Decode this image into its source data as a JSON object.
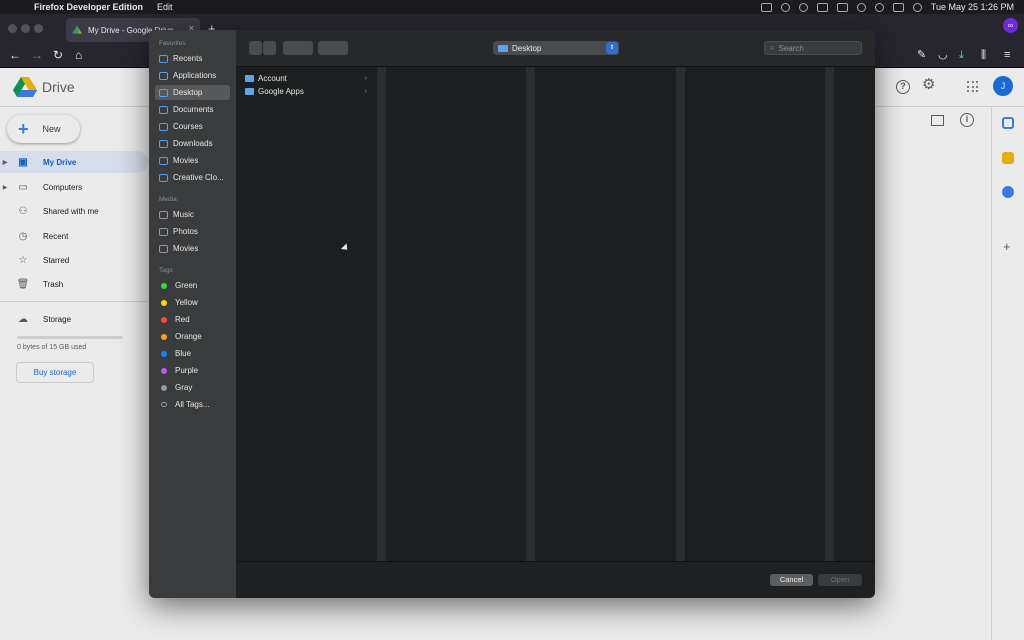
{
  "menubar": {
    "app_name": "Firefox Developer Edition",
    "menu_edit": "Edit",
    "clock": "Tue May 25  1:26 PM"
  },
  "browser": {
    "tab_title": "My Drive - Google Drive",
    "new_tab": "+",
    "close_tab": "×"
  },
  "drive": {
    "brand": "Drive",
    "new_button": "New",
    "nav": [
      {
        "label": "My Drive",
        "icon": "my-drive-icon"
      },
      {
        "label": "Computers",
        "icon": "computers-icon"
      },
      {
        "label": "Shared with me",
        "icon": "shared-icon"
      },
      {
        "label": "Recent",
        "icon": "clock-icon"
      },
      {
        "label": "Starred",
        "icon": "star-icon"
      },
      {
        "label": "Trash",
        "icon": "trash-icon"
      }
    ],
    "storage_label": "Storage",
    "storage_used": "0 bytes of 15 GB used",
    "buy_storage": "Buy storage",
    "avatar_letter": "J",
    "help_icon": "?",
    "info_icon": "i"
  },
  "dialog": {
    "sidebar": {
      "favorites_heading": "Favorites",
      "favorites": [
        "Recents",
        "Applications",
        "Desktop",
        "Documents",
        "Courses",
        "Downloads",
        "Movies",
        "Creative Clo..."
      ],
      "media_heading": "Media",
      "media": [
        "Music",
        "Photos",
        "Movies"
      ],
      "tags_heading": "Tags",
      "tags": [
        {
          "label": "Green",
          "color": "#32d74b"
        },
        {
          "label": "Yellow",
          "color": "#ffd60a"
        },
        {
          "label": "Red",
          "color": "#ff453a"
        },
        {
          "label": "Orange",
          "color": "#ff9f0a"
        },
        {
          "label": "Blue",
          "color": "#0a84ff"
        },
        {
          "label": "Purple",
          "color": "#bf5af2"
        },
        {
          "label": "Gray",
          "color": "#98989d"
        }
      ],
      "all_tags": "All Tags..."
    },
    "location": "Desktop",
    "search_placeholder": "Search",
    "files": [
      "Account",
      "Google Apps"
    ],
    "cancel": "Cancel",
    "open": "Open"
  }
}
